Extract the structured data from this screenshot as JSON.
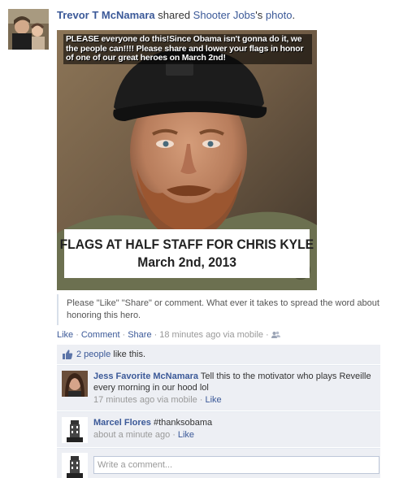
{
  "story": {
    "actor": "Trevor T McNamara",
    "verb": "shared",
    "source": "Shooter Jobs",
    "possessive": "'s",
    "object": "photo",
    "period": "."
  },
  "photo": {
    "top_text": "PLEASE everyone do this!Since Obama isn't gonna do it, we the people can!!!! Please share and lower your flags in honor of one of our great heroes on March 2nd!",
    "banner_line1": "FLAGS AT HALF STAFF FOR CHRIS KYLE",
    "banner_line2": "March 2nd, 2013"
  },
  "caption": "Please \"Like\" \"Share\" or comment. What ever it takes to spread the word about honoring this hero.",
  "actions": {
    "like": "Like",
    "comment": "Comment",
    "share": "Share",
    "time": "18 minutes ago via mobile",
    "separator": "·"
  },
  "likes": {
    "count_link": "2 people",
    "suffix": "like this."
  },
  "comments": [
    {
      "author": "Jess Favorite McNamara",
      "text": "Tell this to the motivator who plays Reveille every morning in our hood lol",
      "time": "17 minutes ago via mobile",
      "like": "Like"
    },
    {
      "author": "Marcel Flores",
      "text": "#thanksobama",
      "time": "about a minute ago",
      "like": "Like"
    }
  ],
  "comment_input": {
    "placeholder": "Write a comment..."
  },
  "icons": {
    "thumbs_up": "thumbs-up-icon",
    "audience": "friends-icon"
  },
  "colors": {
    "link": "#3b5998",
    "ufi_bg": "#edeff4",
    "meta": "#999999"
  }
}
